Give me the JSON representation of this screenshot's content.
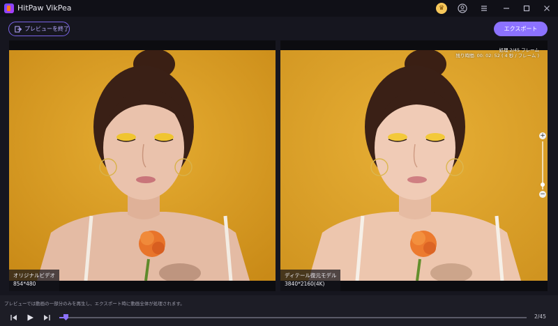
{
  "app": {
    "title": "HitPaw VikPea"
  },
  "titlebar": {
    "icons": [
      "premium-icon",
      "user-icon",
      "menu-icon",
      "minimize-icon",
      "maximize-icon",
      "close-icon"
    ]
  },
  "toolbar": {
    "exit_preview_label": "プレビューを終了",
    "export_label": "エクスポート"
  },
  "preview": {
    "left": {
      "label": "オリジナルビデオ",
      "resolution": "854*480"
    },
    "right": {
      "label": "ディテール復元モデル",
      "resolution": "3840*2160(4K)"
    },
    "progress_line1": "処理 2/45 フレーム",
    "progress_line2": "残り時間: 00: 02: 52 ( 4 秒 / フレーム )"
  },
  "zoom": {
    "level_fraction": 0.1
  },
  "bottom": {
    "notice": "プレビューでは動画の一部分のみを再生し、エクスポート時に動画全体が処理されます。",
    "frame_counter": "2/45",
    "current_frame": 2,
    "total_frames": 45
  },
  "colors": {
    "accent": "#8c72ff",
    "background": "#16161f",
    "backdrop": "#e0a72f"
  }
}
